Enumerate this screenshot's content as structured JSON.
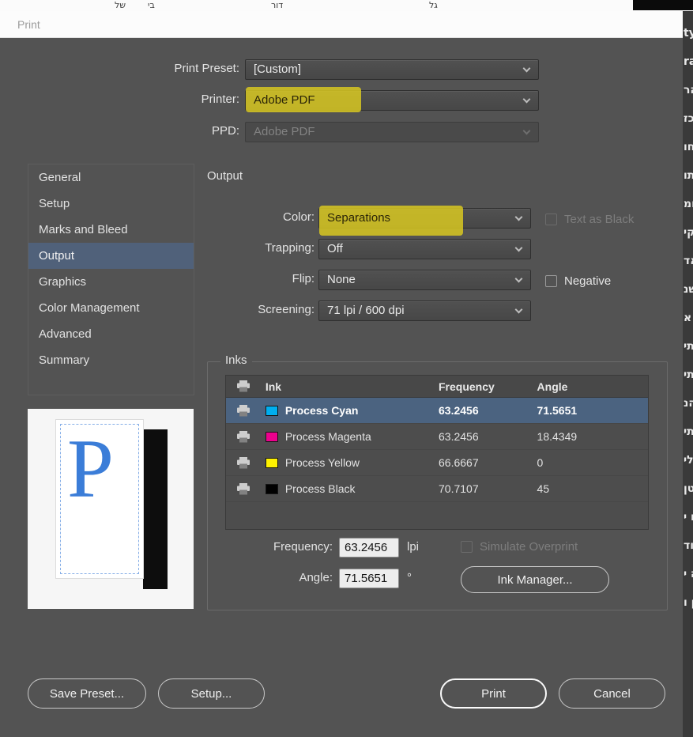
{
  "window": {
    "title": "Print"
  },
  "top_fields": [
    {
      "label": "Print Preset:",
      "value": "[Custom]",
      "disabled": false,
      "highlighted": false
    },
    {
      "label": "Printer:",
      "value": "Adobe PDF",
      "disabled": false,
      "highlighted": true
    },
    {
      "label": "PPD:",
      "value": "Adobe PDF",
      "disabled": true,
      "highlighted": false
    }
  ],
  "sidebar": {
    "items": [
      {
        "label": "General",
        "selected": false
      },
      {
        "label": "Setup",
        "selected": false
      },
      {
        "label": "Marks and Bleed",
        "selected": false
      },
      {
        "label": "Output",
        "selected": true
      },
      {
        "label": "Graphics",
        "selected": false
      },
      {
        "label": "Color Management",
        "selected": false
      },
      {
        "label": "Advanced",
        "selected": false
      },
      {
        "label": "Summary",
        "selected": false
      }
    ]
  },
  "preview": {
    "page_letter": "P"
  },
  "output": {
    "section_title": "Output",
    "rows": [
      {
        "label": "Color:",
        "value": "Separations",
        "highlighted": true
      },
      {
        "label": "Trapping:",
        "value": "Off",
        "highlighted": false
      },
      {
        "label": "Flip:",
        "value": "None",
        "highlighted": false
      },
      {
        "label": "Screening:",
        "value": "71 lpi / 600 dpi",
        "highlighted": false
      }
    ],
    "text_as_black": {
      "label": "Text as Black",
      "checked": false,
      "disabled": true
    },
    "negative": {
      "label": "Negative",
      "checked": false,
      "disabled": false
    },
    "inks": {
      "group_label": "Inks",
      "columns": {
        "ink": "Ink",
        "frequency": "Frequency",
        "angle": "Angle"
      },
      "rows": [
        {
          "name": "Process Cyan",
          "swatch": "#00aeef",
          "frequency": "63.2456",
          "angle": "71.5651",
          "selected": true
        },
        {
          "name": "Process Magenta",
          "swatch": "#ec008c",
          "frequency": "63.2456",
          "angle": "18.4349",
          "selected": false
        },
        {
          "name": "Process Yellow",
          "swatch": "#fff200",
          "frequency": "66.6667",
          "angle": "0",
          "selected": false
        },
        {
          "name": "Process Black",
          "swatch": "#000000",
          "frequency": "70.7107",
          "angle": "45",
          "selected": false
        }
      ]
    },
    "frequency_field": {
      "label": "Frequency:",
      "value": "63.2456",
      "unit": "lpi"
    },
    "angle_field": {
      "label": "Angle:",
      "value": "71.5651",
      "unit": "°"
    },
    "simulate_overprint": {
      "label": "Simulate Overprint",
      "checked": false,
      "disabled": true
    },
    "ink_manager_button": "Ink Manager..."
  },
  "footer": {
    "save_preset": "Save Preset...",
    "setup": "Setup...",
    "print": "Print",
    "cancel": "Cancel"
  },
  "background": {
    "top_fragments": [
      "של",
      "בי",
      "דור",
      "גל"
    ],
    "right_fragments": [
      "ty",
      "ra",
      "הר",
      "כז",
      "חו",
      "תו",
      "חמ",
      "קי",
      "אד",
      "שנ",
      "א",
      "תי",
      "תי",
      "הנ",
      "תי",
      "לי",
      "טן",
      "ם י",
      "וד",
      "ה י",
      "ן ו"
    ]
  },
  "colors": {
    "highlight_marker": "#d8c821",
    "selection_blue": "#4b6380",
    "sidebar_selected": "#50617a",
    "dialog_bg": "#535353"
  }
}
